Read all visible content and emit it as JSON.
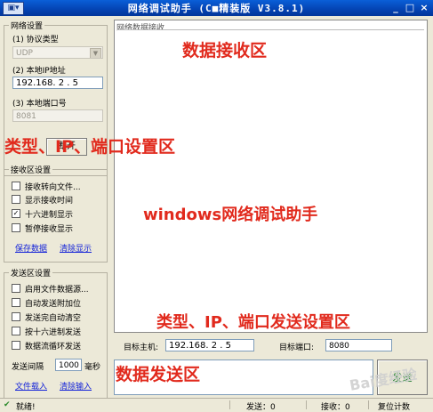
{
  "window": {
    "title": "网络调试助手  (C■精装版 V3.8.1)",
    "app_icon": "▣▾",
    "controls": [
      "_",
      "□",
      "×"
    ]
  },
  "network_settings": {
    "group_title": "网络设置",
    "protocol_label": "(1) 协议类型",
    "protocol_value": "UDP",
    "local_ip_label": "(2) 本地IP地址",
    "local_ip_value": "192.168. 2 . 5",
    "local_port_label": "(3) 本地端口号",
    "local_port_value": "8081",
    "disconnect_button": "断开"
  },
  "receive_settings": {
    "group_title": "接收区设置",
    "options": [
      {
        "label": "接收转向文件...",
        "checked": false
      },
      {
        "label": "显示接收时间",
        "checked": false
      },
      {
        "label": "十六进制显示",
        "checked": true
      },
      {
        "label": "暂停接收显示",
        "checked": false
      }
    ],
    "save_link": "保存数据",
    "clear_link": "清除显示"
  },
  "send_settings": {
    "group_title": "发送区设置",
    "options": [
      {
        "label": "启用文件数据源...",
        "checked": false
      },
      {
        "label": "自动发送附加位",
        "checked": false
      },
      {
        "label": "发送完自动清空",
        "checked": false
      },
      {
        "label": "按十六进制发送",
        "checked": false
      },
      {
        "label": "数据流循环发送",
        "checked": false
      }
    ],
    "interval_label": "发送间隔",
    "interval_value": "1000",
    "interval_unit": "毫秒",
    "load_file_link": "文件载入",
    "clear_input_link": "清除输入"
  },
  "receive_panel": {
    "title": "网络数据接收"
  },
  "target": {
    "host_label": "目标主机:",
    "host_value": "192.168. 2 . 5",
    "port_label": "目标端口:",
    "port_value": "8080"
  },
  "send_button": "发送",
  "status_bar": {
    "status": "就绪!",
    "sent": "发送：0",
    "received": "接收：0",
    "reset": "复位计数"
  },
  "annotations": {
    "receive_area": "数据接收区",
    "type_ip_port": "类型、IP、端口设置区",
    "app_name": "windows网络调试助手",
    "send_settings": "类型、IP、端口发送设置区",
    "send_area": "数据发送区"
  },
  "watermark": "Bai度经验",
  "colors": {
    "annotation": "#e12a1d",
    "title_bar": "#0443b2",
    "link": "#1524d8",
    "send_text": "#1a7a2a"
  }
}
